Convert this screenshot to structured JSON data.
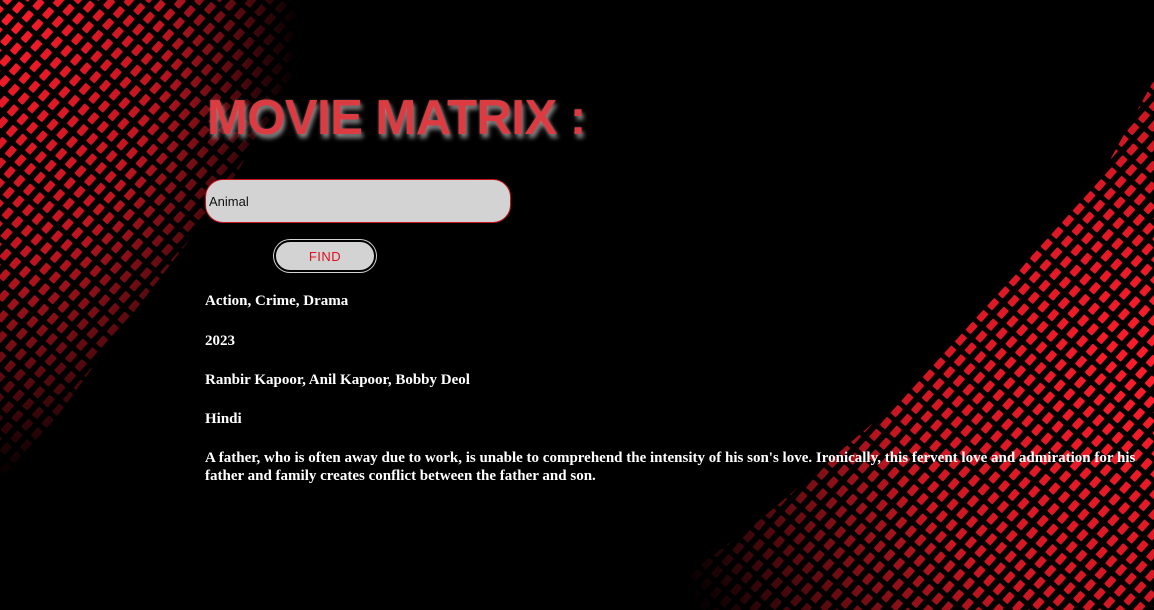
{
  "colors": {
    "background": "#000000",
    "accent_red": "#e0101f",
    "title_red": "#dc3b42",
    "input_bg": "#d3d3d3",
    "text": "#ffffff"
  },
  "header": {
    "title": "MOVIE MATRIX :"
  },
  "search": {
    "value": "Animal",
    "button_label": "FIND"
  },
  "movie": {
    "genre": "Action, Crime, Drama",
    "year": "2023",
    "actors": "Ranbir Kapoor, Anil Kapoor, Bobby Deol",
    "language": "Hindi",
    "plot": "A father, who is often away due to work, is unable to comprehend the intensity of his son's love. Ironically, this fervent love and admiration for his father and family creates conflict between the father and son."
  }
}
